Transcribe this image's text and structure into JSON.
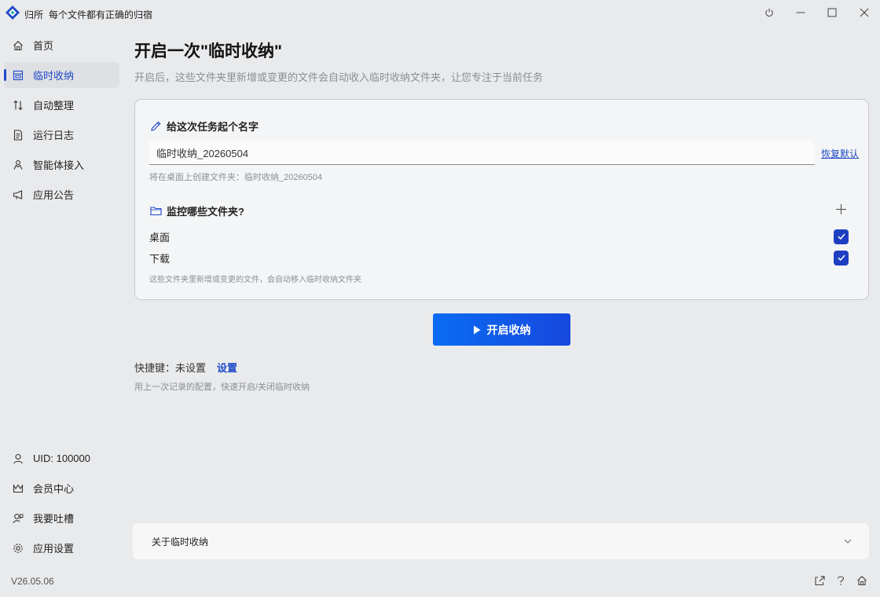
{
  "titlebar": {
    "app_name": "归所",
    "slogan": "每个文件都有正确的归宿"
  },
  "sidebar": {
    "items": [
      {
        "label": "首页",
        "icon": "home-icon"
      },
      {
        "label": "临时收纳",
        "icon": "inbox-icon",
        "active": true
      },
      {
        "label": "自动整理",
        "icon": "sort-arrows-icon"
      },
      {
        "label": "运行日志",
        "icon": "log-document-icon"
      },
      {
        "label": "智能体接入",
        "icon": "agent-icon"
      },
      {
        "label": "应用公告",
        "icon": "megaphone-icon"
      }
    ],
    "bottom_items": [
      {
        "label": "UID: 100000",
        "icon": "user-icon"
      },
      {
        "label": "会员中心",
        "icon": "crown-icon"
      },
      {
        "label": "我要吐槽",
        "icon": "feedback-icon"
      },
      {
        "label": "应用设置",
        "icon": "gear-icon"
      }
    ]
  },
  "main": {
    "title": "开启一次\"临时收纳\"",
    "subtitle": "开启后，这些文件夹里新增或变更的文件会自动收入临时收纳文件夹，让您专注于当前任务",
    "name_section": {
      "title": "给这次任务起个名字",
      "input_value": "临时收纳_20260504",
      "restore_label": "恢复默认",
      "hint": "将在桌面上创建文件夹：临时收纳_20260504"
    },
    "folder_section": {
      "title": "监控哪些文件夹?",
      "folders": [
        {
          "label": "桌面",
          "checked": true
        },
        {
          "label": "下载",
          "checked": true
        }
      ],
      "hint": "这些文件夹里新增或变更的文件，会自动移入临时收纳文件夹"
    },
    "start_button": "开启收纳",
    "shortcut": {
      "label": "快捷键：未设置",
      "set_label": "设置",
      "hint": "用上一次记录的配置，快速开启/关闭临时收纳"
    },
    "about": {
      "label": "关于临时收纳"
    }
  },
  "footer": {
    "version": "V26.05.06"
  },
  "colors": {
    "accent": "#1f49c8",
    "button_gradient_start": "#0a6cf2",
    "button_gradient_end": "#1648de",
    "background": "#e9eaec"
  }
}
